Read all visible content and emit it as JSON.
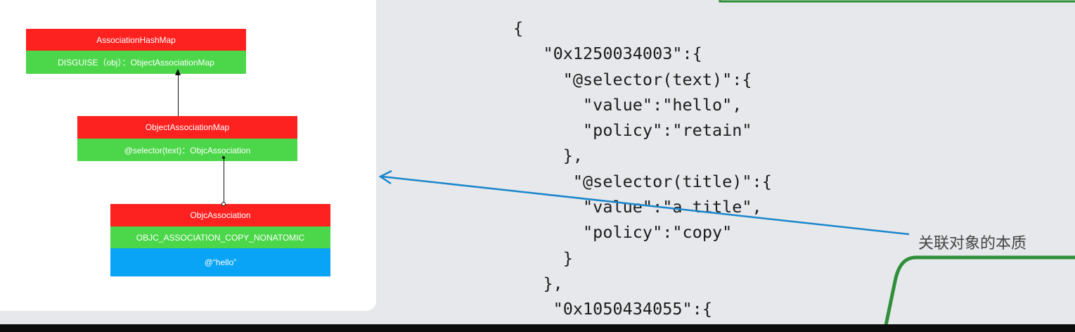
{
  "diagram": {
    "hash_map": {
      "title": "AssociationHashMap",
      "entry": "DISGUISE（obj）：ObjectAssociationMap"
    },
    "object_map": {
      "title": "ObjectAssociationMap",
      "entry": "@selector(text)：ObjcAssociation"
    },
    "association": {
      "title": "ObjcAssociation",
      "policy": "OBJC_ASSOCIATION_COPY_NONATOMIC",
      "value": "@“hello”"
    }
  },
  "code_lines": [
    "{",
    "   \"0x1250034003\":{",
    "     \"@selector(text)\":{",
    "       \"value\":\"hello\",",
    "       \"policy\":\"retain\"",
    "     },",
    "      \"@selector(title)\":{",
    "       \"value\":\"a title\",",
    "       \"policy\":\"copy\"",
    "     }",
    "   },",
    "    \"0x1050434055\":{"
  ],
  "mindmap_node": "关联对象的本质",
  "colors": {
    "title_red": "#fd2220",
    "entry_green": "#4cd74a",
    "value_blue": "#0aa4f6",
    "arrow_blue": "#1a86cc",
    "mindmap_green": "#2f8f3a"
  }
}
